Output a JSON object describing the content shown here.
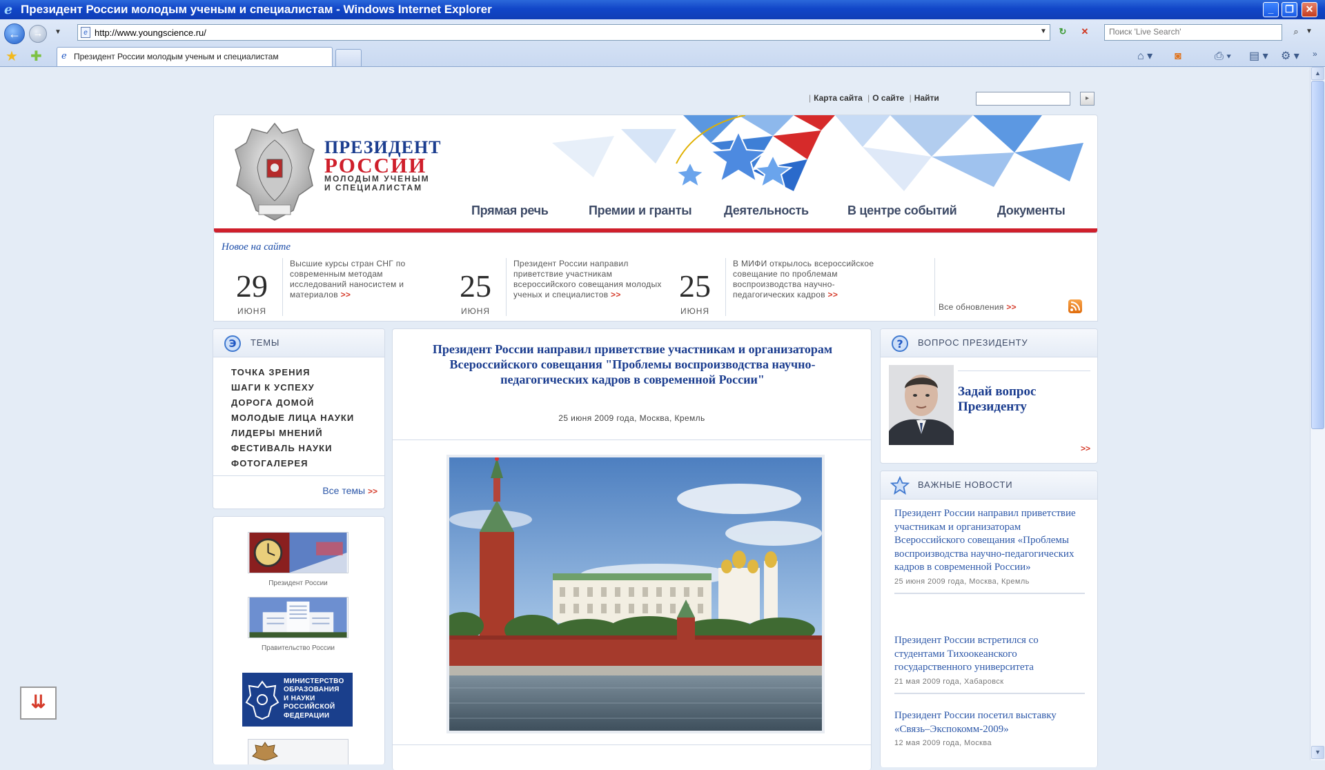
{
  "window": {
    "title": "Президент России молодым ученым и специалистам - Windows Internet Explorer"
  },
  "browser": {
    "url": "http://www.youngscience.ru/",
    "search_placeholder": "Поиск 'Live Search'",
    "tab_title": "Президент России молодым ученым и специалистам"
  },
  "site": {
    "utility_links": [
      "Карта сайта",
      "О сайте",
      "Найти"
    ],
    "brand": {
      "line1": "ПРЕЗИДЕНТ",
      "line2": "РОССИИ",
      "line3": "МОЛОДЫМ УЧЕНЫМ",
      "line4": "И СПЕЦИАЛИСТАМ"
    },
    "nav": [
      "Прямая речь",
      "Премии и гранты",
      "Деятельность",
      "В центре событий",
      "Документы"
    ],
    "news_strip": {
      "heading": "Новое на сайте",
      "items": [
        {
          "day": "29",
          "month": "ИЮНЯ",
          "text": "Высшие курсы стран СНГ по современным методам исследований наносистем и материалов",
          "more": ">>"
        },
        {
          "day": "25",
          "month": "ИЮНЯ",
          "text": "Президент России направил приветствие участникам всероссийского совещания молодых ученых и специалистов",
          "more": ">>"
        },
        {
          "day": "25",
          "month": "ИЮНЯ",
          "text": "В МИФИ открылось всероссийское совещание по проблемам воспроизводства научно-педагогических кадров",
          "more": ">>"
        }
      ],
      "all_updates": "Все обновления",
      "more": ">>"
    },
    "themes": {
      "title": "ТЕМЫ",
      "items": [
        "ТОЧКА ЗРЕНИЯ",
        "ШАГИ К УСПЕХУ",
        "ДОРОГА ДОМОЙ",
        "МОЛОДЫЕ ЛИЦА НАУКИ",
        "ЛИДЕРЫ МНЕНИЙ",
        "ФЕСТИВАЛЬ НАУКИ",
        "ФОТОГАЛЕРЕЯ"
      ],
      "all_label": "Все темы",
      "more": ">>"
    },
    "side_links": [
      {
        "caption": "Президент России"
      },
      {
        "caption": "Правительство России"
      },
      {
        "lines": [
          "МИНИСТЕРСТВО",
          "ОБРАЗОВАНИЯ",
          "И НАУКИ",
          "РОССИЙСКОЙ",
          "ФЕДЕРАЦИИ"
        ]
      }
    ],
    "article": {
      "title": "Президент России направил приветствие участникам и организаторам Всероссийского совещания \"Проблемы воспроизводства научно-педагогических кадров в современной России\"",
      "meta": "25 июня 2009 года, Москва, Кремль"
    },
    "question": {
      "title": "ВОПРОС ПРЕЗИДЕНТУ",
      "link": "Задай вопрос Президенту",
      "more": ">>"
    },
    "important": {
      "title": "ВАЖНЫЕ НОВОСТИ",
      "items": [
        {
          "headline": "Президент России направил приветствие участникам и организаторам Всероссийского совещания «Проблемы воспроизводства научно-педагогических кадров в современной России»",
          "date": "25 июня 2009 года, Москва, Кремль"
        },
        {
          "headline": "Президент России встретился со студентами Тихоокеанского государственного университета",
          "date": "21 мая 2009 года, Хабаровск"
        },
        {
          "headline": "Президент России посетил выставку «Связь–Экспокомм-2009»",
          "date": "12 мая 2009 года, Москва"
        }
      ]
    }
  },
  "colors": {
    "ie_title": "#1146c8",
    "brand_blue": "#1b3d8f",
    "brand_red": "#cf1f2b",
    "link_blue": "#2c57a8",
    "more_red": "#d53b2a"
  },
  "icons": [
    "ie-logo-icon",
    "back-icon",
    "forward-icon",
    "page-icon",
    "refresh-icon",
    "stop-icon",
    "search-icon",
    "star-icon",
    "home-icon",
    "rss-icon",
    "print-icon",
    "page-menu-icon",
    "tools-icon",
    "themes-icon",
    "question-icon",
    "news-star-icon",
    "scroll-down-icon"
  ]
}
